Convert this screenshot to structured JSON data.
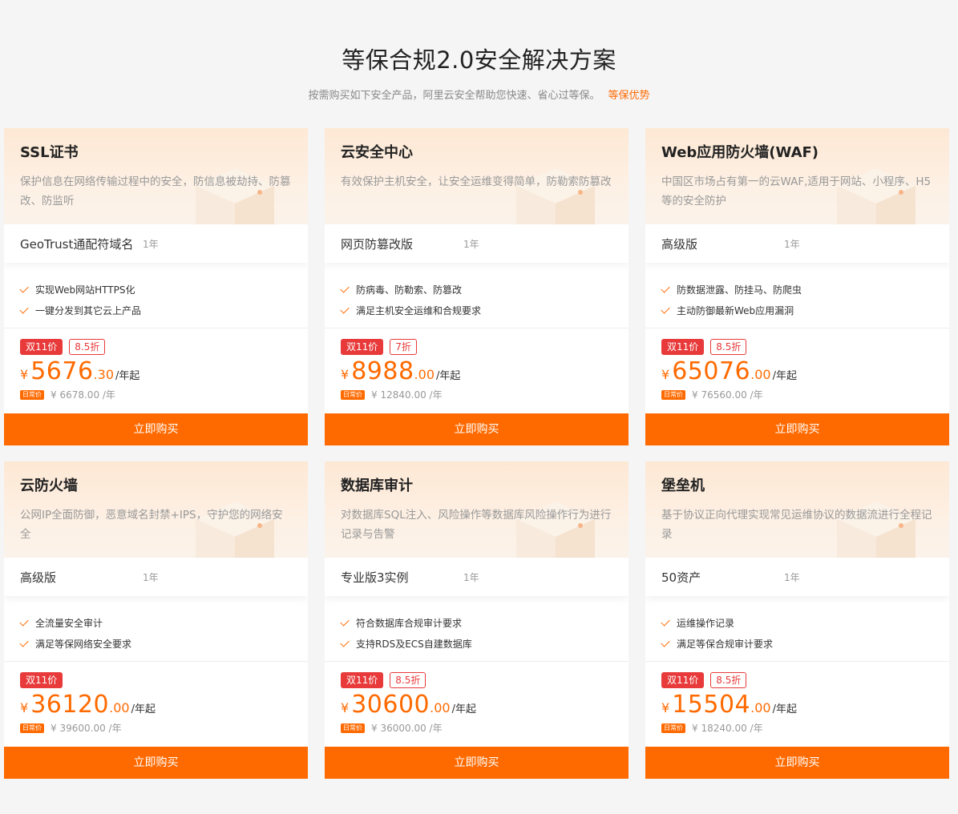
{
  "header": {
    "title": "等保合规2.0安全解决方案",
    "subtitle": "按需购买如下安全产品，阿里云安全帮助您快速、省心过等保。",
    "advantage_link": "等保优势"
  },
  "colors": {
    "accent": "#ff6a00",
    "promo_red": "#e83a3a"
  },
  "cards": [
    {
      "title": "SSL证书",
      "desc": "保护信息在网络传输过程中的安全，防信息被劫持、防篡改、防监听",
      "spec": "GeoTrust通配符域名",
      "duration": "1年",
      "features": [
        "实现Web网站HTTPS化",
        "一键分发到其它云上产品"
      ],
      "badge": "双11价",
      "discount": "8.5折",
      "currency": "¥",
      "price_int": "5676",
      "price_dec": ".30",
      "unit": "/年起",
      "regular_tag": "日常价",
      "regular_price": "¥ 6678.00 /年",
      "button": "立即购买"
    },
    {
      "title": "云安全中心",
      "desc": "有效保护主机安全，让安全运维变得简单，防勒索防篡改",
      "spec": "网页防篡改版",
      "duration": "1年",
      "features": [
        "防病毒、防勒索、防篡改",
        "满足主机安全运维和合规要求"
      ],
      "badge": "双11价",
      "discount": "7折",
      "currency": "¥",
      "price_int": "8988",
      "price_dec": ".00",
      "unit": "/年起",
      "regular_tag": "日常价",
      "regular_price": "¥ 12840.00 /年",
      "button": "立即购买"
    },
    {
      "title": "Web应用防火墙(WAF)",
      "desc": "中国区市场占有第一的云WAF,适用于网站、小程序、H5等的安全防护",
      "spec": "高级版",
      "duration": "1年",
      "features": [
        "防数据泄露、防挂马、防爬虫",
        "主动防御最新Web应用漏洞"
      ],
      "badge": "双11价",
      "discount": "8.5折",
      "currency": "¥",
      "price_int": "65076",
      "price_dec": ".00",
      "unit": "/年起",
      "regular_tag": "日常价",
      "regular_price": "¥ 76560.00 /年",
      "button": "立即购买"
    },
    {
      "title": "云防火墙",
      "desc": "公网IP全面防御，恶意域名封禁+IPS，守护您的网络安全",
      "spec": "高级版",
      "duration": "1年",
      "features": [
        "全流量安全审计",
        "满足等保网络安全要求"
      ],
      "badge": "双11价",
      "discount": "",
      "currency": "¥",
      "price_int": "36120",
      "price_dec": ".00",
      "unit": "/年起",
      "regular_tag": "日常价",
      "regular_price": "¥ 39600.00 /年",
      "button": "立即购买"
    },
    {
      "title": "数据库审计",
      "desc": "对数据库SQL注入、风险操作等数据库风险操作行为进行记录与告警",
      "spec": "专业版3实例",
      "duration": "1年",
      "features": [
        "符合数据库合规审计要求",
        "支持RDS及ECS自建数据库"
      ],
      "badge": "双11价",
      "discount": "8.5折",
      "currency": "¥",
      "price_int": "30600",
      "price_dec": ".00",
      "unit": "/年起",
      "regular_tag": "日常价",
      "regular_price": "¥ 36000.00 /年",
      "button": "立即购买"
    },
    {
      "title": "堡垒机",
      "desc": "基于协议正向代理实现常见运维协议的数据流进行全程记录",
      "spec": "50资产",
      "duration": "1年",
      "features": [
        "运维操作记录",
        "满足等保合规审计要求"
      ],
      "badge": "双11价",
      "discount": "8.5折",
      "currency": "¥",
      "price_int": "15504",
      "price_dec": ".00",
      "unit": "/年起",
      "regular_tag": "日常价",
      "regular_price": "¥ 18240.00 /年",
      "button": "立即购买"
    }
  ]
}
